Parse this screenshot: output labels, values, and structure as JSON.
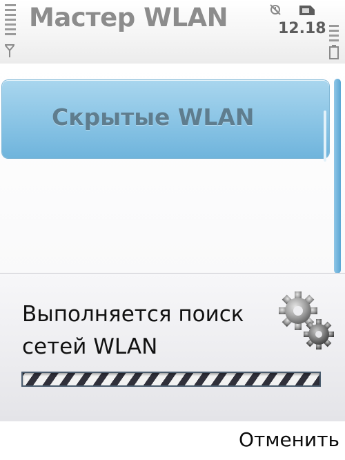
{
  "status_bar": {
    "title": "Мастер WLAN",
    "clock": "12.18",
    "icons": {
      "signal": "signal-strength-icon",
      "antenna": "antenna-icon",
      "alarm": "alarm-icon",
      "sim": "sim-card-icon",
      "battery": "battery-icon"
    }
  },
  "list": {
    "items": [
      {
        "label": "Скрытые WLAN",
        "selected": true
      }
    ]
  },
  "progress_dialog": {
    "message": "Выполняется поиск сетей WLAN",
    "icon": "gears-icon",
    "state": "indeterminate"
  },
  "softkeys": {
    "right": "Отменить"
  },
  "colors": {
    "highlight": "#8dc6e6",
    "scrollbar": "#5aa6d4",
    "title_text": "#8c8c8c",
    "progress_dark": "#30303a"
  }
}
